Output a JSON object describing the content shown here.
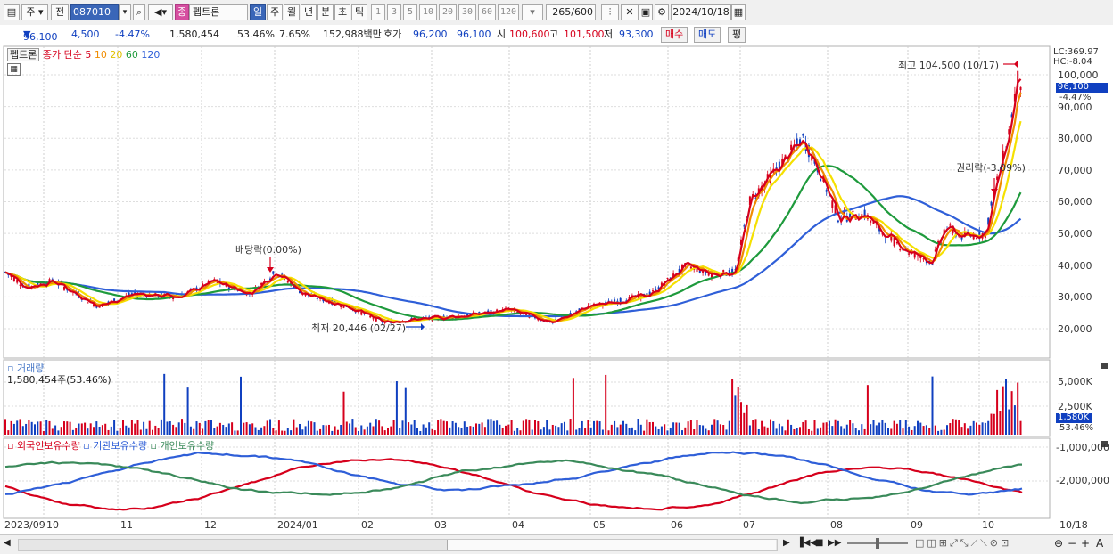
{
  "toolbar": {
    "menu_icon": "chart-menu-icon",
    "period_main": "주",
    "prev_label": "전",
    "code": "087010",
    "name_tag": "종",
    "stock_name": "펩트론",
    "period_day": "일",
    "period_week": "주",
    "period_month": "월",
    "period_year": "년",
    "period_minute": "분",
    "period_second": "초",
    "period_tick": "틱",
    "intervals": [
      "1",
      "3",
      "5",
      "10",
      "20",
      "30",
      "60",
      "120"
    ],
    "count": "265",
    "count_total": "/600",
    "date": "2024/10/18"
  },
  "quote": {
    "price": "96,100",
    "change": "4,500",
    "change_pct": "-4.47%",
    "volume": "1,580,454",
    "volume_ratio": "53.46%",
    "turnover": "7.65%",
    "amount": "152,988백만",
    "bid_label": "호가",
    "bid": "96,200",
    "ask": "96,100",
    "open_label": "시",
    "open": "100,600",
    "high_label": "고",
    "high": "101,500",
    "low_label": "저",
    "low": "93,300",
    "buy_label": "매수",
    "sell_label": "매도",
    "eval_label": "평"
  },
  "price_pane": {
    "legend_name": "펩트론",
    "legend_ma": "종가 단순",
    "ma_periods": [
      "5",
      "10",
      "20",
      "60",
      "120"
    ],
    "ma_colors": [
      "#d6001c",
      "#f08c00",
      "#f5e000",
      "#1e9a3c",
      "#2f5fd8"
    ],
    "lc": "LC:369.97",
    "hc": "HC:-8.04",
    "current": "96,100",
    "current_pct": "-4.47%",
    "y_ticks": [
      "100,000",
      "90,000",
      "80,000",
      "70,000",
      "60,000",
      "50,000",
      "40,000",
      "30,000",
      "20,000"
    ],
    "annotation_high": "최고 104,500 (10/17)",
    "annotation_low": "최저 20,446 (02/27)",
    "annotation_dividend": "배당락(0.00%)",
    "annotation_rights": "권리락(-3.09%)"
  },
  "volume_pane": {
    "title": "거래량",
    "value": "1,580,454주(53.46%)",
    "y_ticks": [
      "5,000K",
      "2,500K"
    ],
    "current": "1,580K",
    "current_pct": "53.46%"
  },
  "holdings_pane": {
    "legend": [
      "외국인보유수량",
      "기관보유수량",
      "개인보유수량"
    ],
    "colors": [
      "#d6001c",
      "#2f5fd8",
      "#3a8a5a"
    ],
    "y_ticks": [
      "-1,000,000",
      "-2,000,000"
    ]
  },
  "x_axis": [
    "2023/09",
    "10",
    "11",
    "12",
    "2024/01",
    "02",
    "03",
    "04",
    "05",
    "06",
    "07",
    "08",
    "09",
    "10",
    "10/18"
  ]
}
